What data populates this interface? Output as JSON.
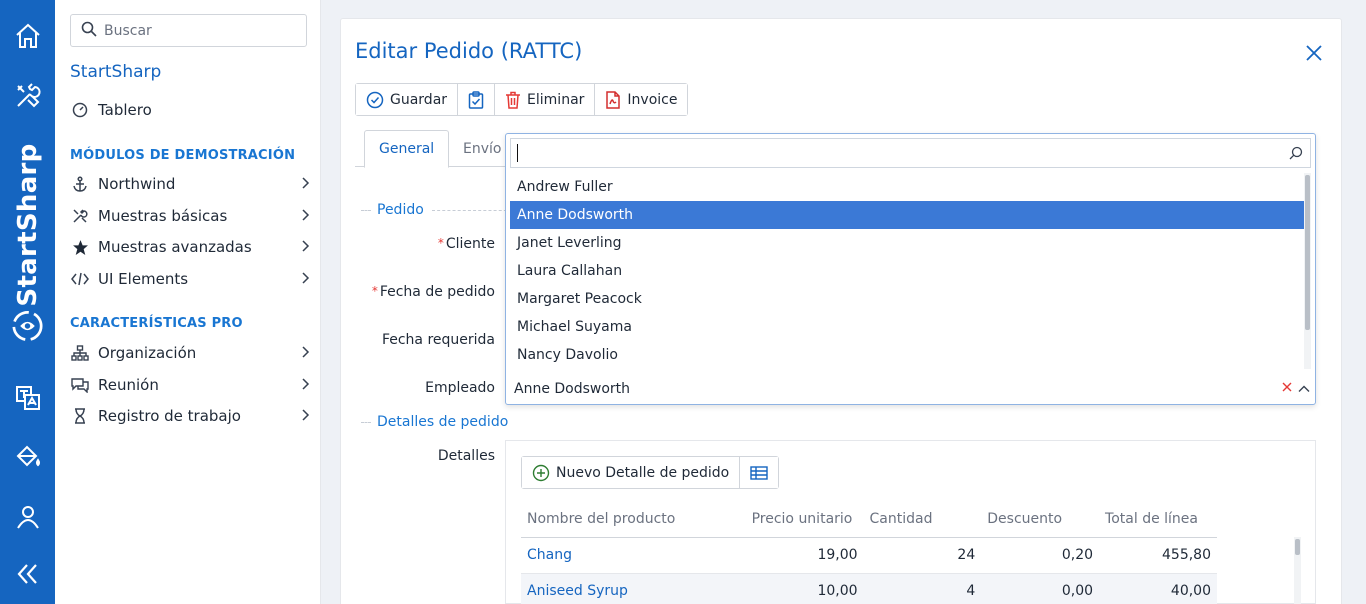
{
  "rail": {
    "brand": "StartSharp",
    "icons": [
      "home-icon",
      "tools-icon",
      "translate-icon",
      "paint-bucket-icon",
      "user-icon",
      "collapse-icon"
    ]
  },
  "sidebar": {
    "search_placeholder": "Buscar",
    "title": "StartSharp",
    "dashboard": "Tablero",
    "section_demo": "MÓDULOS DE DEMOSTRACIÓN",
    "demo_items": [
      "Northwind",
      "Muestras básicas",
      "Muestras avanzadas",
      "UI Elements"
    ],
    "section_pro": "CARACTERÍSTICAS PRO",
    "pro_items": [
      "Organización",
      "Reunión",
      "Registro de trabajo"
    ]
  },
  "dialog": {
    "title": "Editar Pedido (RATTC)",
    "toolbar": {
      "save": "Guardar",
      "delete": "Eliminar",
      "invoice": "Invoice"
    },
    "tabs": [
      "General",
      "Envío"
    ],
    "categories": {
      "order": "Pedido",
      "details": "Detalles de pedido"
    },
    "labels": {
      "customer": "Cliente",
      "order_date": "Fecha de pedido",
      "required_date": "Fecha requerida",
      "employee": "Empleado",
      "details": "Detalles"
    }
  },
  "employee_dropdown": {
    "search_value": "",
    "options": [
      "Andrew Fuller",
      "Anne Dodsworth",
      "Janet Leverling",
      "Laura Callahan",
      "Margaret Peacock",
      "Michael Suyama",
      "Nancy Davolio"
    ],
    "selected": "Anne Dodsworth"
  },
  "details_grid": {
    "new_button": "Nuevo Detalle de pedido",
    "columns": [
      "Nombre del producto",
      "Precio unitario",
      "Cantidad",
      "Descuento",
      "Total de línea"
    ],
    "rows": [
      [
        "Chang",
        "19,00",
        "24",
        "0,20",
        "455,80"
      ],
      [
        "Aniseed Syrup",
        "10,00",
        "4",
        "0,00",
        "40,00"
      ]
    ]
  },
  "colors": {
    "primary": "#1565c0",
    "selected_option": "#3b79d6",
    "required": "#e53935",
    "delete_icon": "#e53935",
    "invoice_icon": "#d32f2f",
    "add_icon": "#2e7d32"
  }
}
